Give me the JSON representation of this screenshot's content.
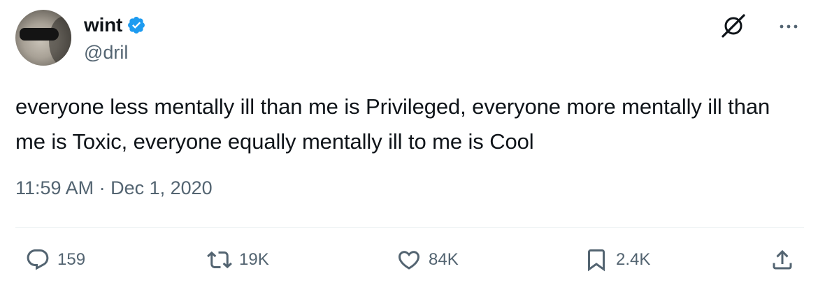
{
  "author": {
    "display_name": "wint",
    "handle": "@dril",
    "verified": true
  },
  "tweet": {
    "text": "everyone less mentally ill than me is Privileged, everyone more mentally ill than me is Toxic, everyone equally mentally ill to me is Cool",
    "timestamp": "11:59 AM · Dec 1, 2020"
  },
  "actions": {
    "replies": "159",
    "reposts": "19K",
    "likes": "84K",
    "bookmarks": "2.4K"
  },
  "colors": {
    "text": "#0f1419",
    "secondary": "#536471",
    "verified_blue": "#1d9bf0",
    "divider": "#eff3f4"
  },
  "icons": [
    "verified-badge-icon",
    "grok-icon",
    "more-icon",
    "reply-icon",
    "repost-icon",
    "like-icon",
    "bookmark-icon",
    "share-icon"
  ]
}
